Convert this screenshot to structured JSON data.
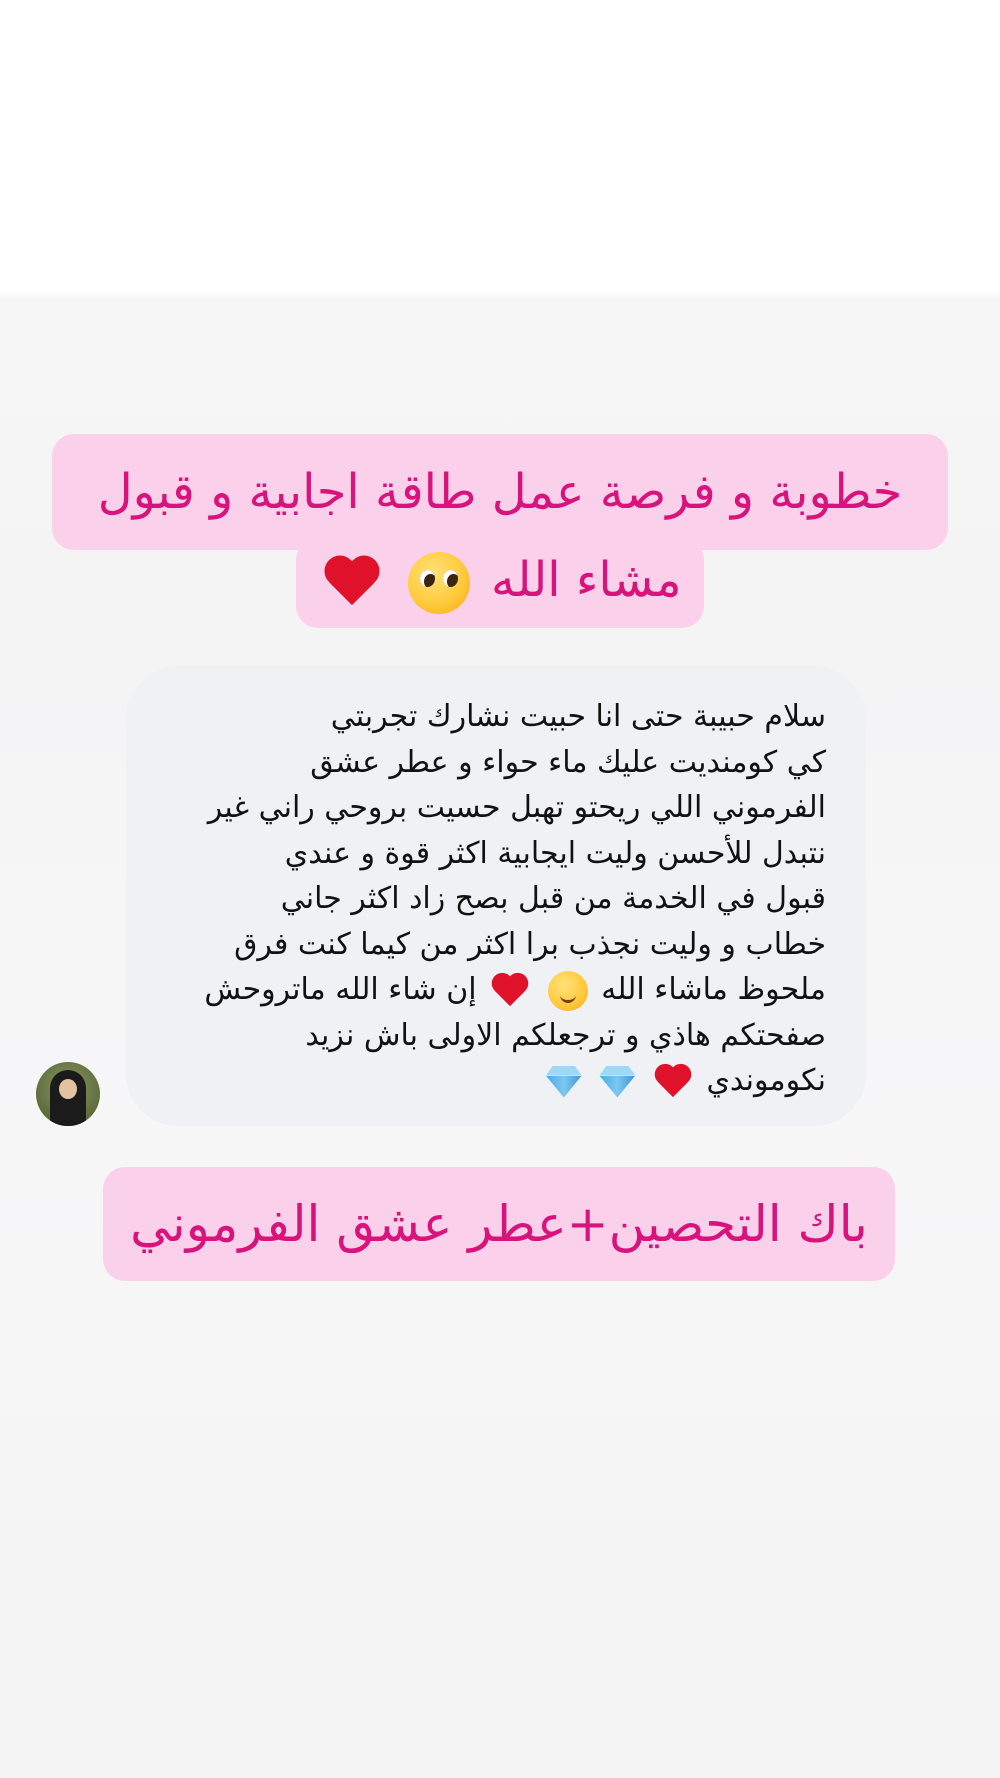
{
  "headline": {
    "line1": "خطوبة و فرصة عمل طاقة اجابية و قبول",
    "line2": "مشاء الله",
    "emojis": [
      "pleading-face-icon",
      "red-heart-icon"
    ],
    "background_color": "#fbd0ea",
    "text_color": "#d8137c"
  },
  "message": {
    "lines": [
      "سلام حبيبة حتى انا حبيت نشارك تجربتي",
      "كي كومنديت عليك ماء حواء و عطر عشق",
      "الفرموني اللي ريحتو تهبل حسيت بروحي راني غير",
      "نتبدل للأحسن وليت ايجابية اكثر قوة و عندي",
      "قبول في الخدمة من قبل بصح زاد اكثر جاني",
      "خطاب و وليت نجذب برا اكثر من كيما كنت فرق",
      "ملحوظ ماشاء الله",
      "إن شاء الله ماتروحش",
      "صفحتكم هاذي و ترجعلكم الاولى باش نزيد",
      "نكوموندي"
    ],
    "emojis_line7": [
      "smiling-face-with-hearts-icon",
      "red-heart-icon"
    ],
    "emojis_line10": [
      "red-heart-icon",
      "gem-icon",
      "gem-icon"
    ],
    "bubble_color": "#f0f1f5",
    "text_color": "#111111"
  },
  "avatar": {
    "icon": "user-avatar"
  },
  "footer": {
    "text": "باك التحصين+عطر عشق الفرموني",
    "background_color": "#fbd0ea",
    "text_color": "#d8137c"
  }
}
